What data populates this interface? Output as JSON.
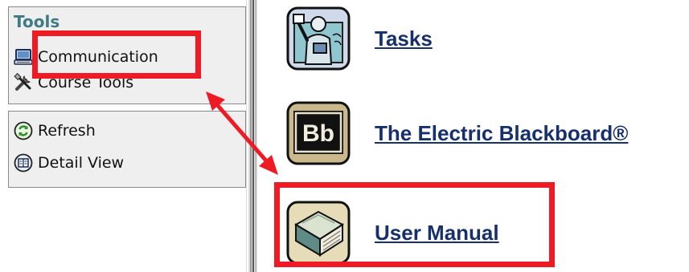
{
  "sidebar": {
    "tools_title": "Tools",
    "tools_items": [
      {
        "label": "Communication",
        "icon": "computer-icon"
      },
      {
        "label": "Course Tools",
        "icon": "tools-icon"
      }
    ],
    "action_items": [
      {
        "label": "Refresh",
        "icon": "refresh-icon"
      },
      {
        "label": "Detail View",
        "icon": "detail-view-icon"
      }
    ]
  },
  "content": {
    "links": [
      {
        "label": "Tasks",
        "icon": "teacher-icon"
      },
      {
        "label": "The Electric Blackboard®",
        "icon": "blackboard-bb-icon"
      },
      {
        "label": "User Manual",
        "icon": "book-icon"
      }
    ]
  },
  "annotations": {
    "highlight_color": "#ee1b24",
    "highlighted": [
      "Communication",
      "User Manual"
    ]
  },
  "colors": {
    "title": "#3f7a86",
    "link": "#16306e",
    "panel_bg": "#efefef"
  }
}
